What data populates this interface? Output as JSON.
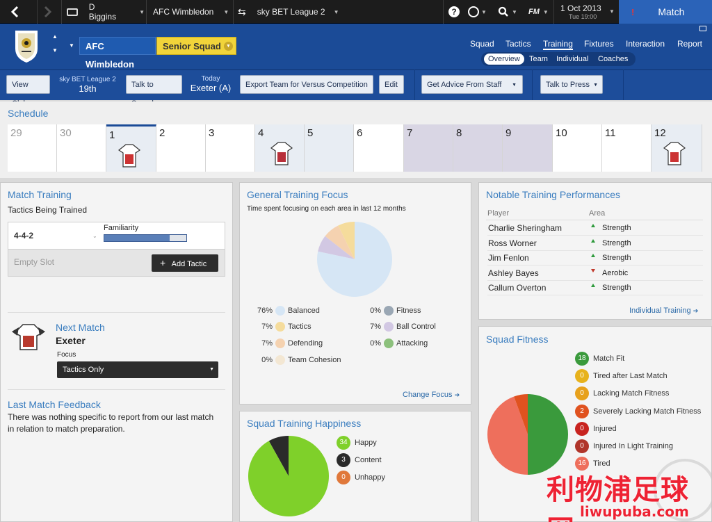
{
  "topbar": {
    "manager": "D Biggins",
    "club": "AFC Wimbledon",
    "league": "sky BET League 2",
    "brand": "FM",
    "date": "1 Oct 2013",
    "weekday": "Tue 19:00",
    "match_label": "Match"
  },
  "header": {
    "club_chip": "AFC Wimbledon",
    "squad_chip": "Senior Squad",
    "nav": [
      "Squad",
      "Tactics",
      "Training",
      "Fixtures",
      "Interaction",
      "Report"
    ],
    "subtabs": [
      "Overview",
      "Team",
      "Individual",
      "Coaches"
    ]
  },
  "toolbar": {
    "view_club": "View Club",
    "league": "sky BET League 2",
    "position": "19th",
    "talk_squad": "Talk to Squad",
    "today_label": "Today",
    "today_match": "Exeter (A)",
    "export": "Export Team for Versus Competition",
    "edit": "Edit",
    "advice": "Get Advice From Staff",
    "press": "Talk to Press"
  },
  "schedule": {
    "title": "Schedule",
    "days": [
      "29",
      "30",
      "1",
      "2",
      "3",
      "4",
      "5",
      "6",
      "7",
      "8",
      "9",
      "10",
      "11",
      "12"
    ]
  },
  "match_training": {
    "title": "Match Training",
    "subtitle": "Tactics Being Trained",
    "tactic": "4-4-2",
    "familiarity_label": "Familiarity",
    "familiarity": 0.8,
    "empty_slot": "Empty Slot",
    "add_tactic": "Add Tactic"
  },
  "next_match": {
    "title": "Next Match",
    "opponent": "Exeter",
    "focus_label": "Focus",
    "focus_value": "Tactics Only"
  },
  "last_feedback": {
    "title": "Last Match Feedback",
    "text_line1": "There was nothing specific to report from our last match",
    "text_line2": "in relation to match preparation."
  },
  "training_focus": {
    "title": "General Training Focus",
    "subtitle": "Time spent focusing on each area in last 12 months",
    "items": [
      {
        "pct": "76%",
        "label": "Balanced",
        "color": "#d6e6f5",
        "value": 76
      },
      {
        "pct": "7%",
        "label": "Tactics",
        "color": "#f5dc9c",
        "value": 7
      },
      {
        "pct": "7%",
        "label": "Defending",
        "color": "#f5d2b0",
        "value": 7
      },
      {
        "pct": "0%",
        "label": "Team Cohesion",
        "color": "#f3e7d3",
        "value": 0
      },
      {
        "pct": "0%",
        "label": "Fitness",
        "color": "#9aa7b4",
        "value": 0
      },
      {
        "pct": "7%",
        "label": "Ball Control",
        "color": "#d2c8e3",
        "value": 7
      },
      {
        "pct": "0%",
        "label": "Attacking",
        "color": "#8cc07c",
        "value": 0
      }
    ],
    "change_focus": "Change Focus"
  },
  "notable": {
    "title": "Notable Training Performances",
    "col_player": "Player",
    "col_area": "Area",
    "rows": [
      {
        "player": "Charlie Sheringham",
        "area": "Strength",
        "trend": "up"
      },
      {
        "player": "Ross Worner",
        "area": "Strength",
        "trend": "up"
      },
      {
        "player": "Jim Fenlon",
        "area": "Strength",
        "trend": "up"
      },
      {
        "player": "Ashley Bayes",
        "area": "Aerobic",
        "trend": "down"
      },
      {
        "player": "Callum Overton",
        "area": "Strength",
        "trend": "up"
      }
    ],
    "link": "Individual Training"
  },
  "happiness": {
    "title": "Squad Training Happiness",
    "items": [
      {
        "count": "34",
        "label": "Happy",
        "color": "#7fd02a",
        "value": 34
      },
      {
        "count": "3",
        "label": "Content",
        "color": "#2a2a2a",
        "value": 3
      },
      {
        "count": "0",
        "label": "Unhappy",
        "color": "#e0783a",
        "value": 0
      }
    ]
  },
  "fitness": {
    "title": "Squad Fitness",
    "items": [
      {
        "count": "18",
        "label": "Match Fit",
        "color": "#3a9a3c",
        "value": 18
      },
      {
        "count": "0",
        "label": "Tired after Last Match",
        "color": "#e7b21c",
        "value": 0
      },
      {
        "count": "0",
        "label": "Lacking Match Fitness",
        "color": "#e7a11c",
        "value": 0
      },
      {
        "count": "2",
        "label": "Severely Lacking Match Fitness",
        "color": "#e0521f",
        "value": 2
      },
      {
        "count": "0",
        "label": "Injured",
        "color": "#c8231f",
        "value": 0
      },
      {
        "count": "0",
        "label": "Injured In Light Training",
        "color": "#b0352a",
        "value": 0
      },
      {
        "count": "16",
        "label": "Tired",
        "color": "#ee6f5c",
        "value": 16
      }
    ]
  },
  "watermark": {
    "cn": "利物浦足球网",
    "url": "liwupuba.com"
  }
}
